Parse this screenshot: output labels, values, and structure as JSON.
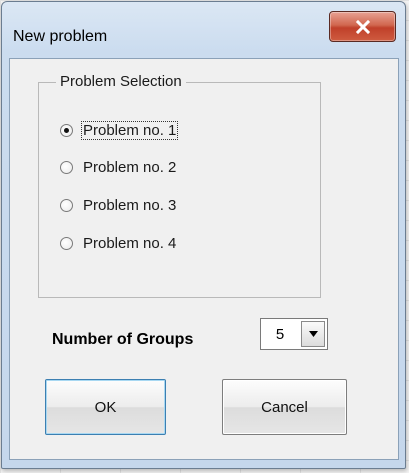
{
  "window": {
    "title": "New problem",
    "close_icon": "close-icon"
  },
  "problem_selection": {
    "legend": "Problem Selection",
    "options": [
      {
        "label": "Problem no. 1",
        "selected": true
      },
      {
        "label": "Problem no. 2",
        "selected": false
      },
      {
        "label": "Problem no. 3",
        "selected": false
      },
      {
        "label": "Problem no. 4",
        "selected": false
      }
    ]
  },
  "groups": {
    "label": "Number of Groups",
    "value": "5"
  },
  "buttons": {
    "ok": "OK",
    "cancel": "Cancel"
  },
  "colors": {
    "close_button": "#c9523b",
    "title_bar": "#cbdcef",
    "client_bg": "#f0f0f0"
  }
}
